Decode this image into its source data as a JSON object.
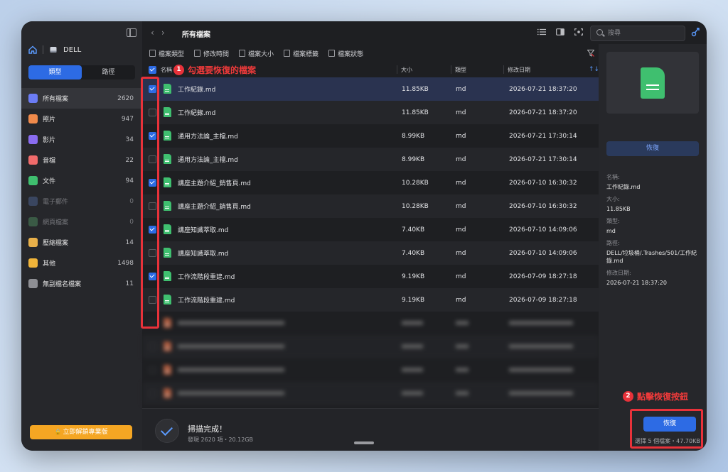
{
  "sidebar": {
    "device": "DELL",
    "tabs": [
      "類型",
      "路徑"
    ],
    "categories": [
      {
        "label": "所有檔案",
        "count": "2620",
        "color": "#6b7cf5"
      },
      {
        "label": "照片",
        "count": "947",
        "color": "#f08a4b"
      },
      {
        "label": "影片",
        "count": "34",
        "color": "#8a6cf0"
      },
      {
        "label": "音檔",
        "count": "22",
        "color": "#f06b6b"
      },
      {
        "label": "文件",
        "count": "94",
        "color": "#3fbf6f"
      },
      {
        "label": "電子郵件",
        "count": "0",
        "color": "#3a4660"
      },
      {
        "label": "網頁檔案",
        "count": "0",
        "color": "#3a5a45"
      },
      {
        "label": "壓縮檔案",
        "count": "14",
        "color": "#e8b04a"
      },
      {
        "label": "其他",
        "count": "1498",
        "color": "#f0b43a"
      },
      {
        "label": "無副檔名檔案",
        "count": "11",
        "color": "#8e8f94"
      }
    ],
    "upgrade": "立即解鎖專業版"
  },
  "topbar": {
    "breadcrumb": "所有檔案",
    "search_placeholder": "搜尋"
  },
  "filters": [
    "檔案類型",
    "修改時間",
    "檔案大小",
    "檔案標籤",
    "檔案狀態"
  ],
  "table": {
    "headers": {
      "name": "名稱",
      "size": "大小",
      "type": "類型",
      "date": "修改日期"
    },
    "rows": [
      {
        "name": "工作紀錄.md",
        "size": "11.85KB",
        "type": "md",
        "date": "2026-07-21 18:37:20",
        "checked": true
      },
      {
        "name": "工作紀錄.md",
        "size": "11.85KB",
        "type": "md",
        "date": "2026-07-21 18:37:20",
        "checked": false
      },
      {
        "name": "通用方法論_主檔.md",
        "size": "8.99KB",
        "type": "md",
        "date": "2026-07-21 17:30:14",
        "checked": true
      },
      {
        "name": "通用方法論_主檔.md",
        "size": "8.99KB",
        "type": "md",
        "date": "2026-07-21 17:30:14",
        "checked": false
      },
      {
        "name": "講座主題介紹_銷售頁.md",
        "size": "10.28KB",
        "type": "md",
        "date": "2026-07-10 16:30:32",
        "checked": true
      },
      {
        "name": "講座主題介紹_銷售頁.md",
        "size": "10.28KB",
        "type": "md",
        "date": "2026-07-10 16:30:32",
        "checked": false
      },
      {
        "name": "講座知識萃取.md",
        "size": "7.40KB",
        "type": "md",
        "date": "2026-07-10 14:09:06",
        "checked": true
      },
      {
        "name": "講座知識萃取.md",
        "size": "7.40KB",
        "type": "md",
        "date": "2026-07-10 14:09:06",
        "checked": false
      },
      {
        "name": "工作流階段重建.md",
        "size": "9.19KB",
        "type": "md",
        "date": "2026-07-09 18:27:18",
        "checked": true
      },
      {
        "name": "工作流階段重建.md",
        "size": "9.19KB",
        "type": "md",
        "date": "2026-07-09 18:27:18",
        "checked": false
      }
    ]
  },
  "annotations": {
    "step1_num": "1",
    "step1": "勾選要恢復的檔案",
    "step2_num": "2",
    "step2": "點擊恢復按鈕"
  },
  "status": {
    "title": "掃描完成！",
    "subtitle": "發現 2620 項・20.12GB"
  },
  "panel": {
    "recover": "恢復",
    "name_label": "名稱:",
    "name": "工作紀錄.md",
    "size_label": "大小:",
    "size": "11.85KB",
    "type_label": "類型:",
    "type": "md",
    "path_label": "路徑:",
    "path": "DELL/垃圾桶/.Trashes/501/工作紀錄.md",
    "date_label": "修改日期:",
    "date": "2026-07-21 18:37:20"
  },
  "footer": {
    "recover_button": "恢復",
    "selection_info": "選擇 5 個檔案・47.70KB"
  }
}
